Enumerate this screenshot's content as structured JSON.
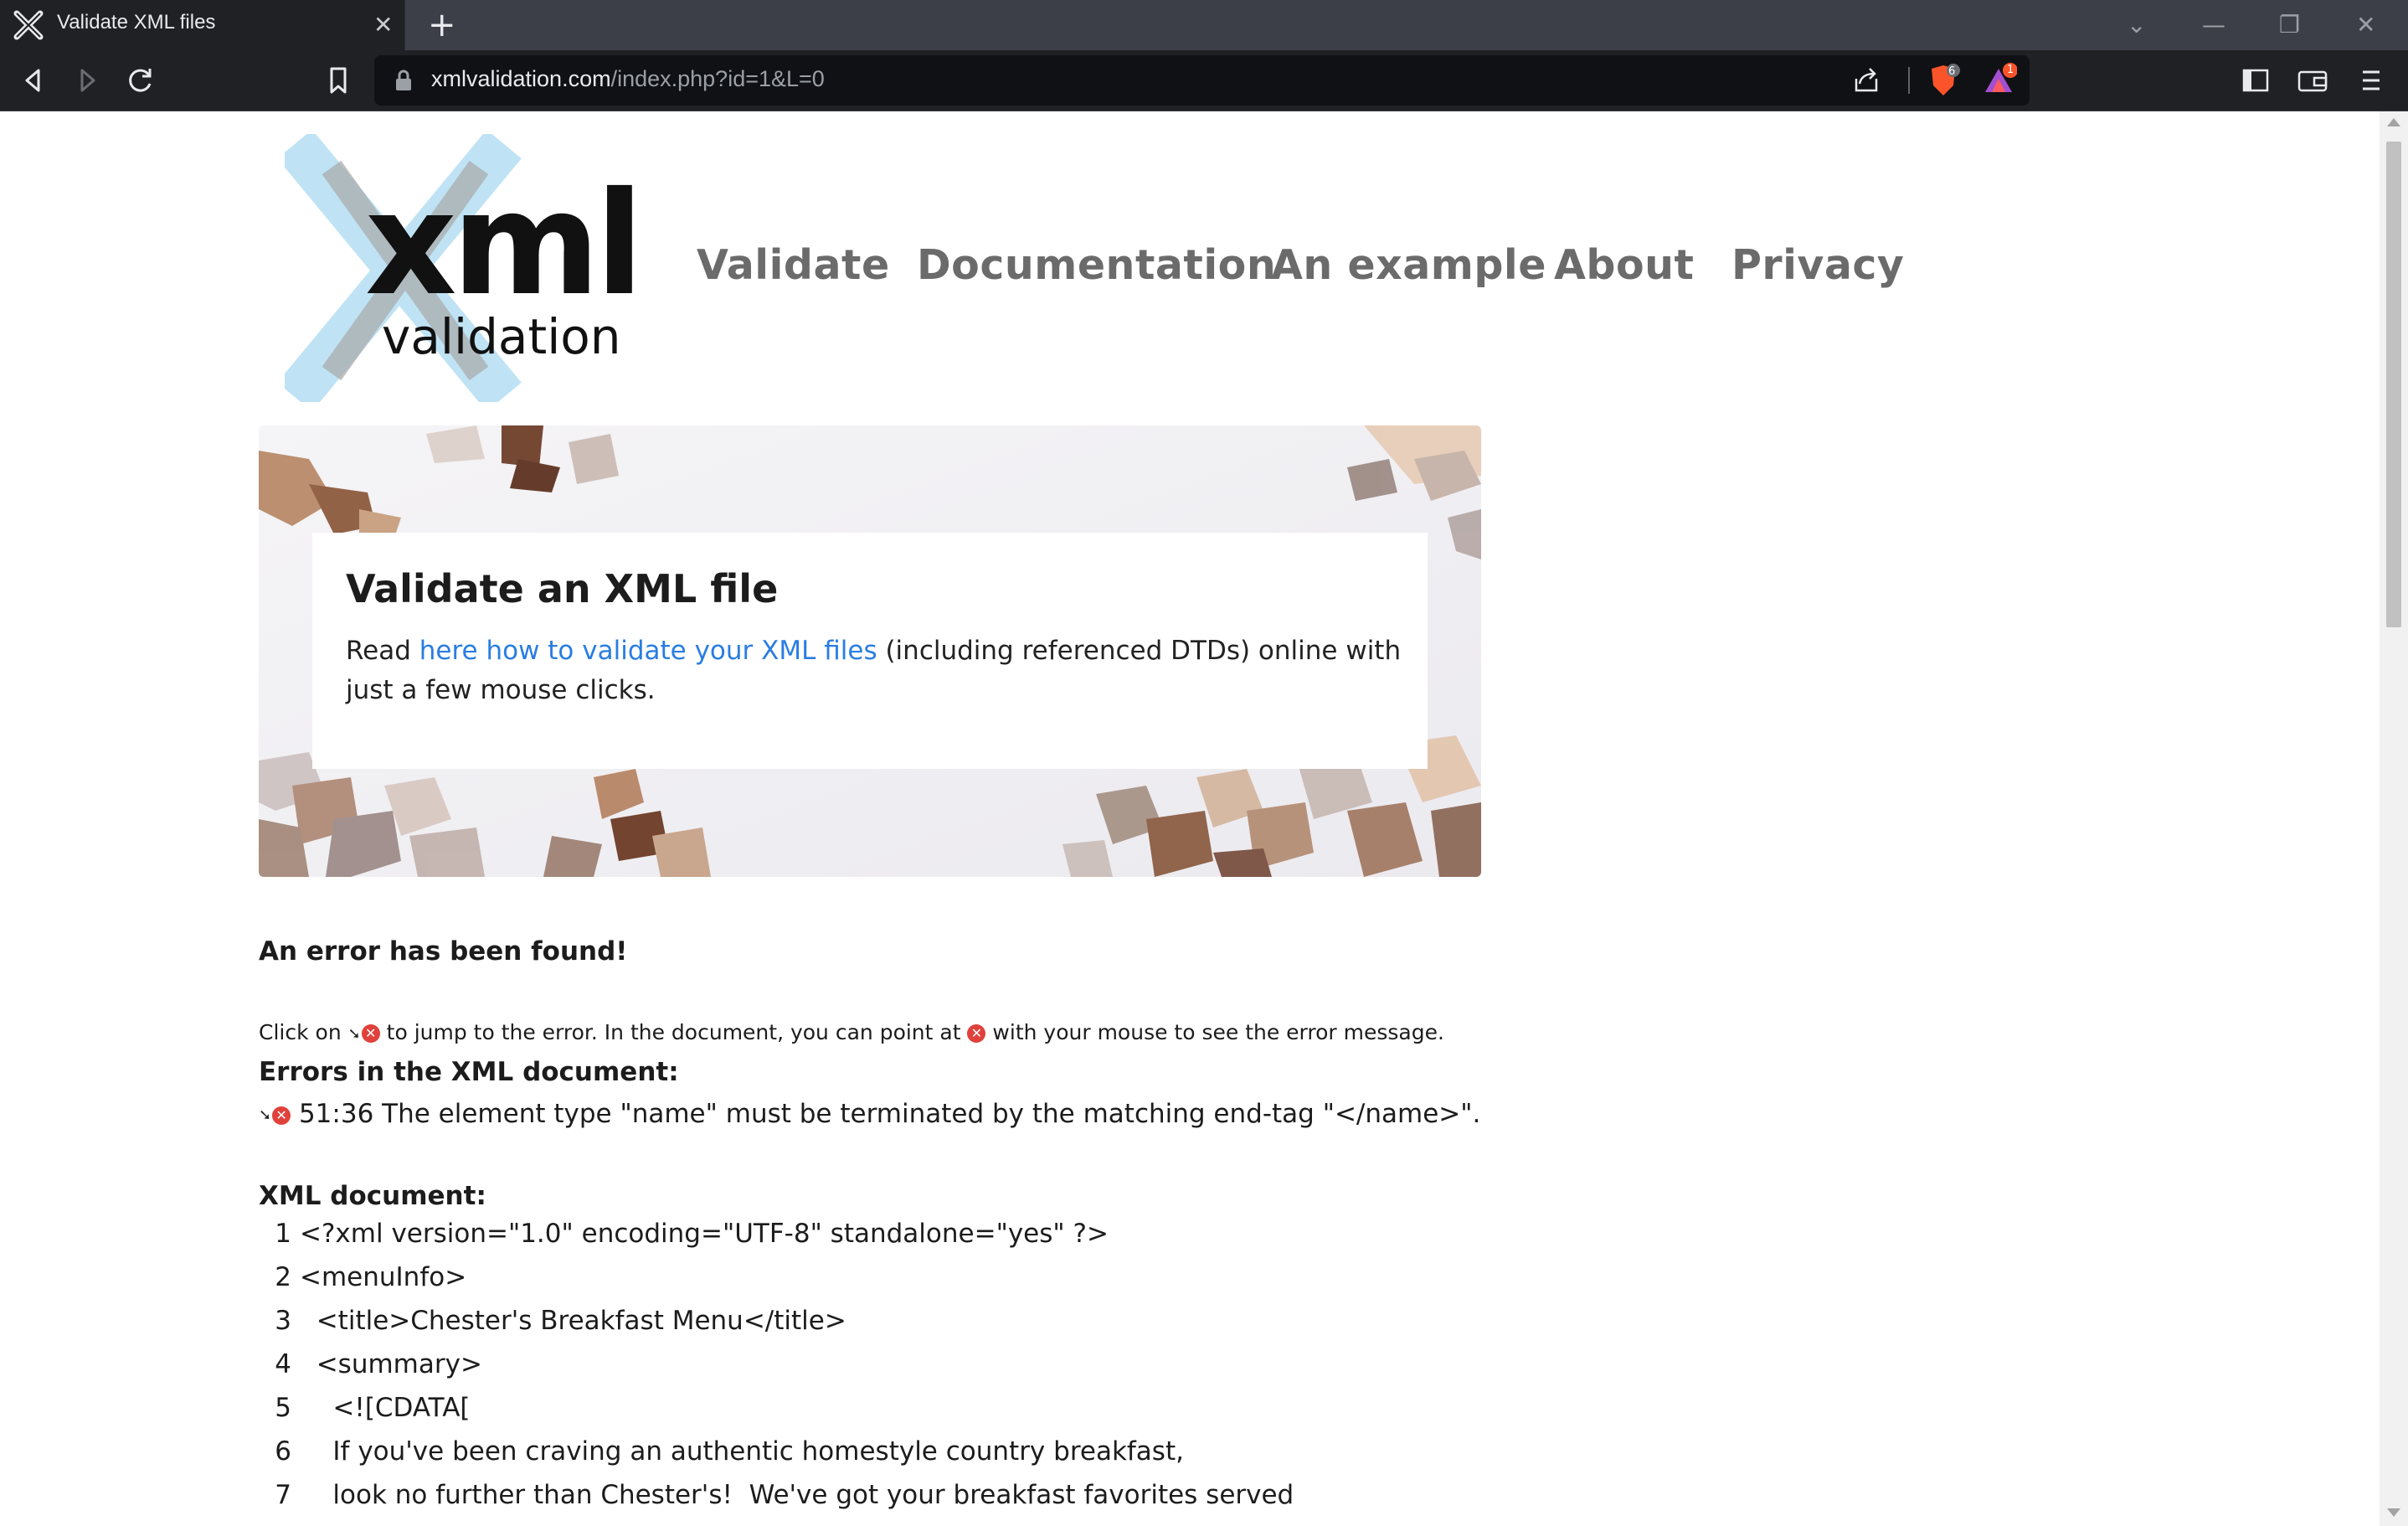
{
  "browser": {
    "tab_title": "Validate XML files",
    "url_host": "xmlvalidation.com",
    "url_path": "/index.php?id=1&L=0",
    "shields_count": "6",
    "rewards_count": "1"
  },
  "logo": {
    "mark": "xml",
    "sub": "validation"
  },
  "nav": {
    "items": [
      "Validate",
      "Documentation",
      "An example",
      "About",
      "Privacy"
    ]
  },
  "hero": {
    "title": "Validate an XML file",
    "text_before": "Read ",
    "link_text": "here how to validate your XML files",
    "text_after": " (including referenced DTDs) online with just a few mouse clicks."
  },
  "result": {
    "heading": "An error has been found!",
    "hint_part1": "Click on ",
    "hint_part2": " to jump to the error. In the document, you can point at ",
    "hint_part3": " with your mouse to see the error message.",
    "errors_heading": "Errors in the XML document:",
    "errors": [
      {
        "location": "51:36",
        "message": "The element type \"name\" must be terminated by the matching end-tag \"</name>\"."
      }
    ],
    "doc_heading": "XML document:"
  },
  "document_lines": [
    {
      "n": "1",
      "text": "<?xml version=\"1.0\" encoding=\"UTF-8\" standalone=\"yes\" ?>"
    },
    {
      "n": "2",
      "text": "<menuInfo>"
    },
    {
      "n": "3",
      "text": "  <title>Chester's Breakfast Menu</title>"
    },
    {
      "n": "4",
      "text": "  <summary>"
    },
    {
      "n": "5",
      "text": "    <![CDATA["
    },
    {
      "n": "6",
      "text": "    If you've been craving an authentic homestyle country breakfast,"
    },
    {
      "n": "7",
      "text": "    look no further than Chester's!  We've got your breakfast favorites served"
    }
  ],
  "colors": {
    "link": "#2a7de1",
    "nav": "#6b6b6b",
    "error_icon": "#e0413b",
    "logo_x": "#bfe3f5"
  }
}
